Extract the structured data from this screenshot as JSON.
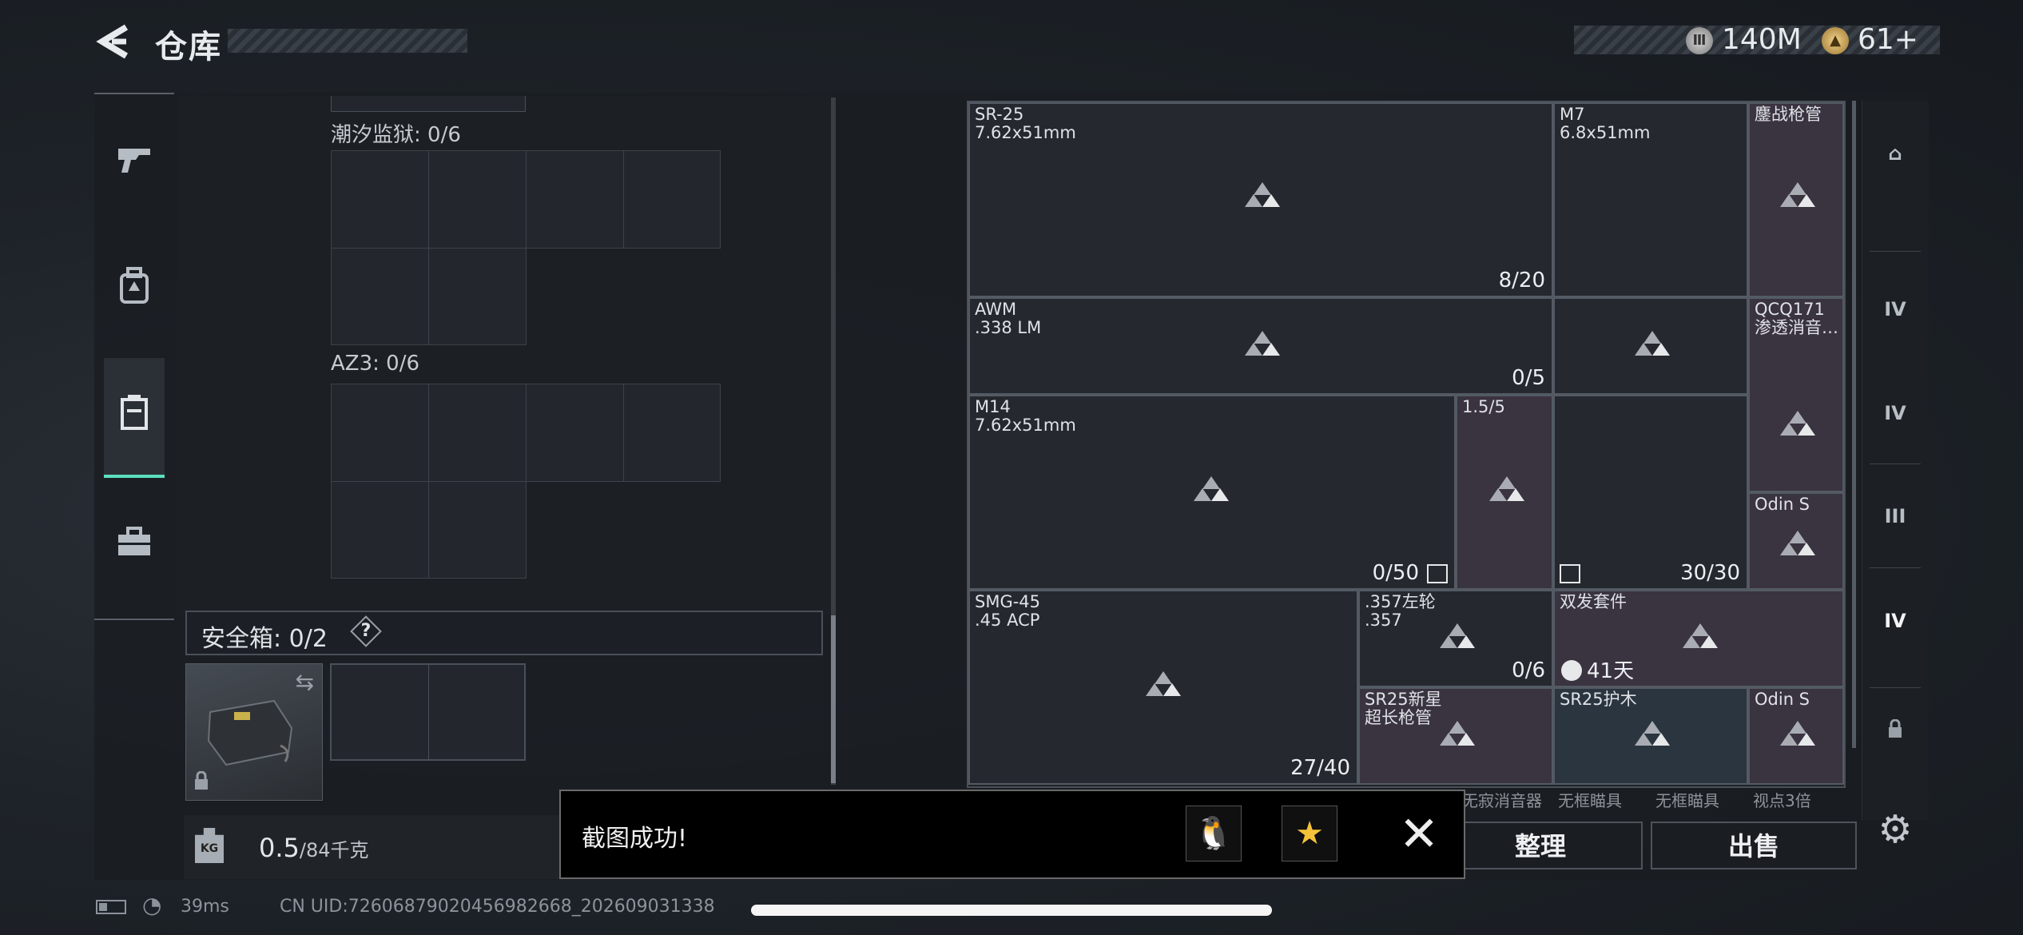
{
  "header": {
    "title": "仓库",
    "back_icon": "back-arrow-icon"
  },
  "currency": [
    {
      "icon": "silver-coin-icon",
      "value": "140M"
    },
    {
      "icon": "gold-coin-icon",
      "value": "61+"
    }
  ],
  "nav": [
    {
      "icon": "pistol-icon",
      "glyph": "⌐"
    },
    {
      "icon": "backpack-icon",
      "glyph": "▣"
    },
    {
      "icon": "case-icon",
      "glyph": "▤"
    },
    {
      "icon": "toolbox-icon",
      "glyph": "▬"
    }
  ],
  "left_panel": {
    "container1": {
      "name": "潮汐监狱: 0/6"
    },
    "container2": {
      "name": "AZ3: 0/6"
    },
    "safe": {
      "label": "安全箱:  0/2",
      "help": "?"
    },
    "weight": {
      "value": "0.5",
      "capacity": "/84千克",
      "icon_text": "KG"
    }
  },
  "grid": {
    "items": [
      {
        "name": "SR-25\n7.62x51mm",
        "count": "8/20"
      },
      {
        "name": "M7\n6.8x51mm",
        "count": ""
      },
      {
        "name": "鏖战枪管",
        "count": ""
      },
      {
        "name": "AWM\n.338 LM",
        "count": ""
      },
      {
        "name": "",
        "count": "0/5"
      },
      {
        "name": "QCQ171\n渗透消音…",
        "count": ""
      },
      {
        "name": "M14\n7.62x51mm",
        "count": "0/50"
      },
      {
        "name": "1.5/5",
        "count": ""
      },
      {
        "name": "",
        "count": "30/30"
      },
      {
        "name": "Odin S",
        "count": ""
      },
      {
        "name": "SMG-45\n.45 ACP",
        "count": "27/40"
      },
      {
        "name": ".357左轮\n.357",
        "count": "0/6"
      },
      {
        "name": "双发套件",
        "count": "41天"
      },
      {
        "name": "SR25新星\n超长枪管",
        "count": ""
      },
      {
        "name": "SR25护木",
        "count": ""
      },
      {
        "name": "Odin S",
        "count": ""
      }
    ],
    "under_labels": [
      "无寂消音器",
      "无框瞄具",
      "无框瞄具",
      "视点3倍"
    ]
  },
  "categories": [
    {
      "icon": "helmet-icon",
      "text": "⌂"
    },
    {
      "icon": "category-iv-weapon-icon",
      "text": "IV"
    },
    {
      "icon": "category-iv-attachment-icon",
      "text": "IV"
    },
    {
      "icon": "category-iii-icon",
      "text": "III"
    },
    {
      "icon": "category-iv-selected-icon",
      "text": "IV"
    },
    {
      "icon": "lock-icon",
      "text": "🔒"
    }
  ],
  "actions": {
    "sort": "整理",
    "sell": "出售"
  },
  "toast": {
    "message": "截图成功!",
    "qq_icon": "🐧",
    "qzone_icon": "★",
    "close": "✕"
  },
  "status": {
    "ping": "39ms",
    "uid": "CN UID:7260687902045698​2668_202609031338"
  }
}
